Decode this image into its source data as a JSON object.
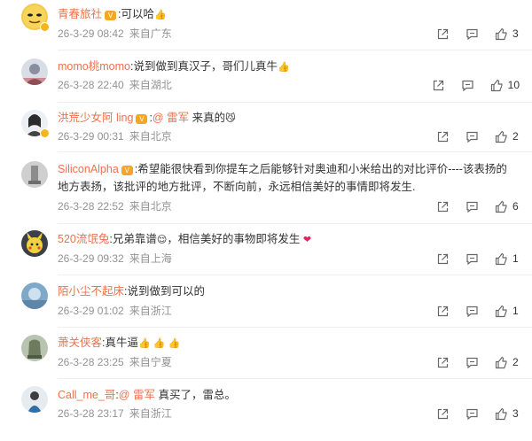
{
  "comments": [
    {
      "user": "青春旅社",
      "separator": ":",
      "text": "可以哈",
      "emoji": "👍",
      "time": "26-3-29 08:42",
      "location": "来自广东",
      "likes": "3"
    },
    {
      "user": "momo桃momo",
      "separator": ":",
      "text": "说到做到真汉子，哥们儿真牛",
      "emoji": "👍",
      "time": "26-3-28 22:40",
      "location": "来自湖北",
      "likes": "10"
    },
    {
      "user": "洪荒少女阿 ling",
      "separator": ":",
      "mention": "@ 雷军",
      "text": " 来真的",
      "emoji": "😼",
      "time": "26-3-29 00:31",
      "location": "来自北京",
      "likes": "2"
    },
    {
      "user": "SiliconAlpha",
      "separator": ":",
      "text": "希望能很快看到你提车之后能够针对奥迪和小米给出的对比评价----该表扬的",
      "text2": "地方表扬，该批评的地方批评，不断向前，永远相信美好的事情即将发生.",
      "time": "26-3-28 22:52",
      "location": "来自北京",
      "likes": "6"
    },
    {
      "user": "520流氓兔",
      "separator": ":",
      "text": "兄弟靠谱",
      "emoji": "😌",
      "text_after": "，相信美好的事物即将发生",
      "emoji2": "❤",
      "time": "26-3-29 09:32",
      "location": "来自上海",
      "likes": "1"
    },
    {
      "user": "陌小尘不起床",
      "separator": ":",
      "text": "说到做到可以的",
      "time": "26-3-29 01:02",
      "location": "来自浙江",
      "likes": "1"
    },
    {
      "user": "萧关侠客",
      "separator": ":",
      "text": "真牛逼",
      "emoji": "👍 👍 👍",
      "time": "26-3-28 23:25",
      "location": "来自宁夏",
      "likes": "2"
    },
    {
      "user": "Call_me_哥",
      "separator": ":",
      "mention": "@ 雷军",
      "text": " 真买了，雷总。",
      "time": "26-3-28 23:17",
      "location": "来自浙江",
      "likes": "3"
    }
  ],
  "icons": {
    "share": "share-icon",
    "reply": "comment-icon",
    "like": "thumbs-up-icon"
  },
  "colors": {
    "username": "#eb7350",
    "meta": "#939393",
    "vip_badge": "#f5a623",
    "verified_badge": "#f6b618"
  }
}
